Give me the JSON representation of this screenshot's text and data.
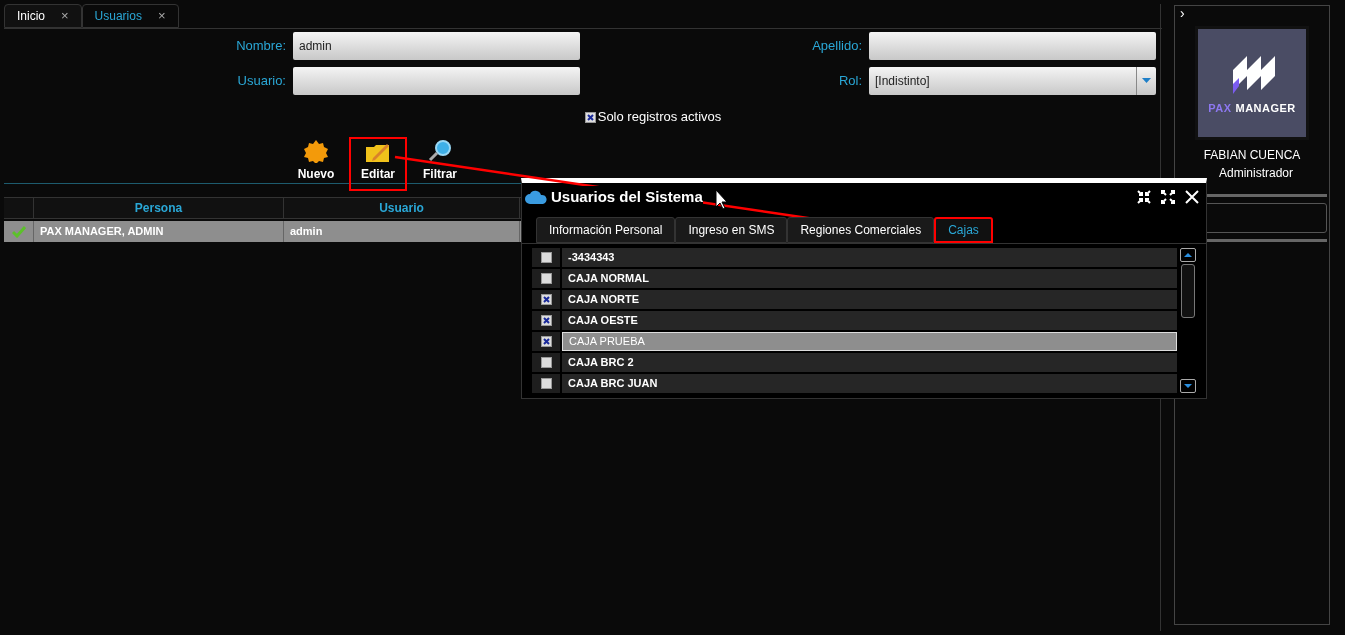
{
  "tabs": [
    {
      "label": "Inicio",
      "selected": false,
      "close": "×"
    },
    {
      "label": "Usuarios",
      "selected": true,
      "close": "×"
    }
  ],
  "filters": {
    "nombre": {
      "label": "Nombre:",
      "value": "admin"
    },
    "apellido": {
      "label": "Apellido:"
    },
    "usuario": {
      "label": "Usuario:"
    },
    "rol": {
      "label": "Rol:",
      "value": "[Indistinto]"
    },
    "solo_activos": {
      "label": "Solo registros activos",
      "checked": true
    }
  },
  "toolbar": [
    {
      "kind": "new",
      "label": "Nuevo",
      "highlighted": false
    },
    {
      "kind": "edit",
      "label": "Editar",
      "highlighted": true
    },
    {
      "kind": "filter",
      "label": "Filtrar",
      "highlighted": false
    }
  ],
  "grid": {
    "columns": [
      "Persona",
      "Usuario"
    ],
    "rows": [
      {
        "active": true,
        "selected": true,
        "cells": [
          "PAX MANAGER, ADMIN",
          "admin"
        ]
      }
    ]
  },
  "dialog": {
    "title": "Usuarios del Sistema",
    "tabs": [
      {
        "label": "Información Personal",
        "selected": false,
        "highlighted": false
      },
      {
        "label": "Ingreso en SMS",
        "selected": false,
        "highlighted": false
      },
      {
        "label": "Regiones Comerciales",
        "selected": false,
        "highlighted": false
      },
      {
        "label": "Cajas",
        "selected": true,
        "highlighted": true
      }
    ],
    "items": [
      {
        "label": "-3434343",
        "checked": false,
        "selected": false
      },
      {
        "label": "CAJA NORMAL",
        "checked": false,
        "selected": false
      },
      {
        "label": "CAJA NORTE",
        "checked": true,
        "selected": false
      },
      {
        "label": "CAJA OESTE",
        "checked": true,
        "selected": false
      },
      {
        "label": "CAJA PRUEBA",
        "checked": true,
        "selected": true
      },
      {
        "label": "CAJA BRC 2",
        "checked": false,
        "selected": false
      },
      {
        "label": "CAJA BRC JUAN",
        "checked": false,
        "selected": false
      }
    ]
  },
  "sidebar": {
    "toggle": "›",
    "logo": {
      "first": "PAX",
      "second": "MANAGER"
    },
    "user_name": "FABIAN CUENCA",
    "role": "Administrador"
  }
}
